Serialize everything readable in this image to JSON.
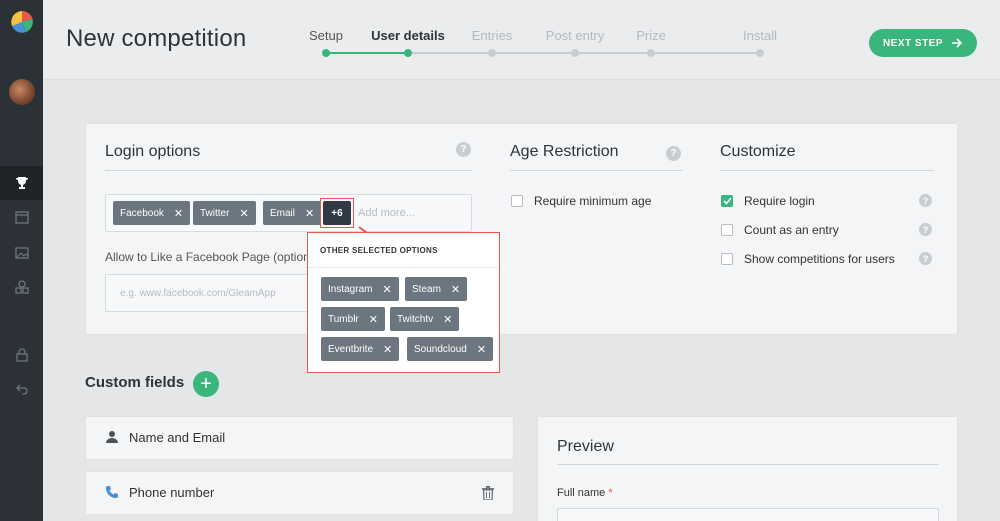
{
  "header": {
    "title": "New competition",
    "next_label": "NEXT STEP",
    "steps": [
      {
        "label": "Setup",
        "state": "done"
      },
      {
        "label": "User details",
        "state": "active"
      },
      {
        "label": "Entries",
        "state": "todo"
      },
      {
        "label": "Post entry",
        "state": "todo"
      },
      {
        "label": "Prize",
        "state": "todo"
      },
      {
        "label": "Install",
        "state": "todo"
      }
    ]
  },
  "sidebar": {
    "items": [
      "trophy-icon",
      "calendar-icon",
      "image-icon",
      "shapes-icon",
      "lock-icon",
      "undo-icon"
    ],
    "active": "trophy-icon"
  },
  "login": {
    "title": "Login options",
    "tags": [
      "Facebook",
      "Twitter",
      "Email"
    ],
    "more_count": "+6",
    "placeholder": "Add more...",
    "fb_label": "Allow to Like a Facebook Page (optional)",
    "fb_placeholder": "e.g. www.facebook.com/GleamApp"
  },
  "popup": {
    "title": "OTHER SELECTED OPTIONS",
    "tags": [
      "Instagram",
      "Steam",
      "Tumblr",
      "Twitchtv",
      "Eventbrite",
      "Soundcloud"
    ]
  },
  "age": {
    "title": "Age Restriction",
    "option": "Require minimum age"
  },
  "customize": {
    "title": "Customize",
    "options": [
      {
        "label": "Require login",
        "checked": true
      },
      {
        "label": "Count as an entry",
        "checked": false
      },
      {
        "label": "Show competitions for users",
        "checked": false
      }
    ]
  },
  "custom_fields": {
    "title": "Custom fields",
    "rows": [
      "Name and Email",
      "Phone number"
    ]
  },
  "preview": {
    "title": "Preview",
    "field_label": "Full name",
    "required_mark": "*"
  },
  "help_glyph": "?",
  "colors": {
    "accent": "#3ab57c",
    "highlight": "#e8594a",
    "sidebar": "#2b3136",
    "tag": "#6b7680"
  }
}
